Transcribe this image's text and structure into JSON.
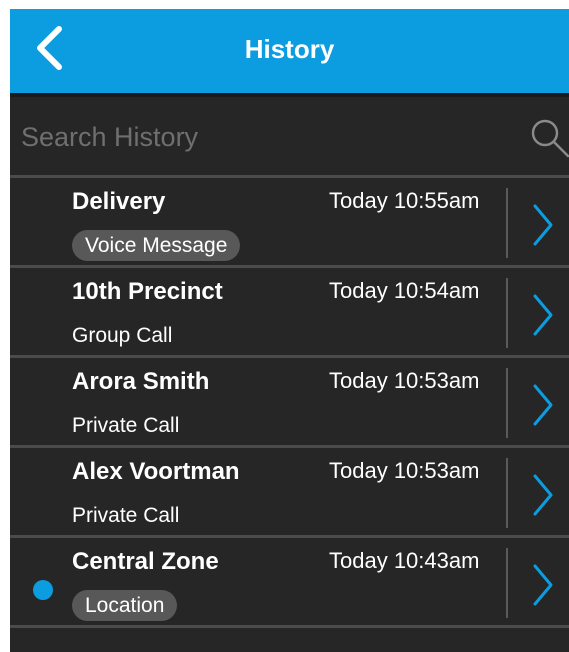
{
  "header": {
    "title": "History",
    "back_icon": "chevron-left-icon"
  },
  "search": {
    "placeholder": "Search History",
    "value": "",
    "icon": "search-icon"
  },
  "colors": {
    "header_bg": "#0c9ce0",
    "accent": "#0c9ce0",
    "unread_dot": "#0c9ce0",
    "background": "#262626",
    "pill_bg": "#585858"
  },
  "history": [
    {
      "name": "Delivery",
      "time": "Today 10:55am",
      "type": "Voice Message",
      "type_style": "pill",
      "unread": false
    },
    {
      "name": "10th Precinct",
      "time": "Today 10:54am",
      "type": "Group Call",
      "type_style": "plain",
      "unread": false
    },
    {
      "name": "Arora Smith",
      "time": "Today 10:53am",
      "type": "Private Call",
      "type_style": "plain",
      "unread": false
    },
    {
      "name": "Alex Voortman",
      "time": "Today 10:53am",
      "type": "Private Call",
      "type_style": "plain",
      "unread": false
    },
    {
      "name": "Central Zone",
      "time": "Today 10:43am",
      "type": "Location",
      "type_style": "pill",
      "unread": true
    }
  ]
}
